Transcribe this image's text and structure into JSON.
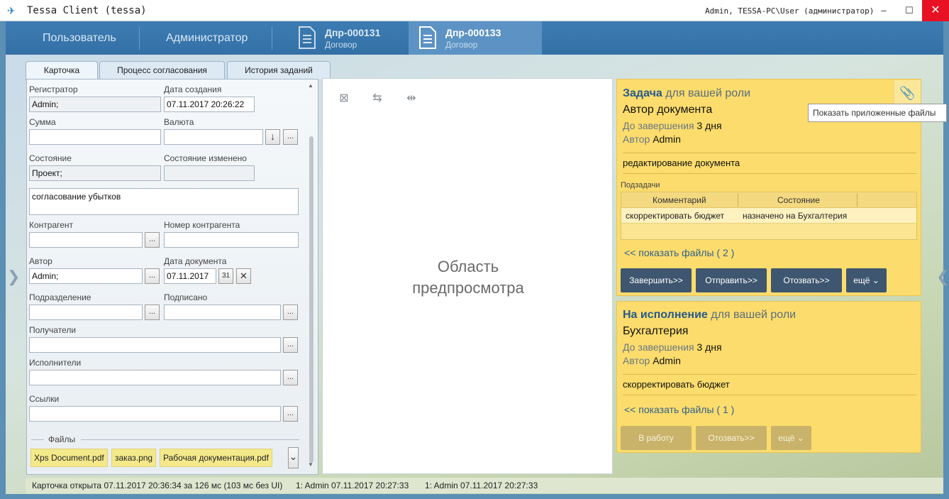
{
  "window": {
    "title": "Tessa Client (tessa)",
    "user": "Admin, TESSA-PC\\User (администратор)",
    "min_label": "–",
    "max_label": "☐",
    "close_label": "✕"
  },
  "nav": {
    "user": "Пользователь",
    "admin": "Администратор",
    "docs": [
      {
        "title": "Дпр-000131",
        "sub": "Договор"
      },
      {
        "title": "Дпр-000133",
        "sub": "Договор"
      }
    ]
  },
  "tabs": [
    "Карточка",
    "Процесс согласования",
    "История заданий"
  ],
  "card": {
    "registrar_label": "Регистратор",
    "registrar_value": "Admin;",
    "created_label": "Дата создания",
    "created_value": "07.11.2017  20:26:22",
    "sum_label": "Сумма",
    "sum_value": "",
    "currency_label": "Валюта",
    "currency_value": "",
    "state_label": "Состояние",
    "state_value": "Проект;",
    "state_changed_label": "Состояние изменено",
    "state_changed_value": "",
    "description": "согласование убытков",
    "partner_label": "Контрагент",
    "partner_value": "",
    "partner_number_label": "Номер контрагента",
    "partner_number_value": "",
    "author_label": "Автор",
    "author_value": "Admin;",
    "doc_date_label": "Дата документа",
    "doc_date_value": "07.11.2017",
    "calendar_day": "31",
    "department_label": "Подразделение",
    "department_value": "",
    "signed_label": "Подписано",
    "signed_value": "",
    "recipients_label": "Получатели",
    "executors_label": "Исполнители",
    "links_label": "Ссылки",
    "files_label": "Файлы",
    "files": [
      "Xps Document.pdf",
      "заказ.png",
      "Рабочая документация.pdf"
    ],
    "ellipsis": "...",
    "download_arrow": "↓",
    "clear_x": "✕",
    "dropdown_arrow": "⌄"
  },
  "preview": {
    "caption": "Область предпросмотра",
    "tool_close": "⊠",
    "tool_swap": "⇆",
    "tool_split": "⇹"
  },
  "tasks": [
    {
      "kind": "Задача",
      "for_role": "для вашей роли",
      "role": "Автор документа",
      "due_label": "До завершения",
      "due_value": "3 дня",
      "author_label": "Автор",
      "author_value": "Admin",
      "text": "редактирование документа",
      "subtasks_label": "Подзадачи",
      "subtasks_cols": [
        "Комментарий",
        "Состояние"
      ],
      "subtasks": [
        {
          "comment": "скорректировать бюджет",
          "state": "назначено на Бухгалтерия"
        }
      ],
      "files_link": "<< показать файлы ( 2 )",
      "buttons": [
        "Завершить>>",
        "Отправить>>",
        "Отозвать>>",
        "ещё ⌄"
      ]
    },
    {
      "kind": "На исполнение",
      "for_role": "для вашей роли",
      "role": "Бухгалтерия",
      "due_label": "До завершения",
      "due_value": "3 дня",
      "author_label": "Автор",
      "author_value": "Admin",
      "text": "скорректировать бюджет",
      "files_link": "<< показать файлы ( 1 )",
      "buttons": [
        "В работу",
        "Отозвать>>",
        "ещё ⌄"
      ]
    }
  ],
  "tooltip": "Показать приложенные файлы",
  "status": {
    "opened": "Карточка открыта 07.11.2017 20:36:34 за 126 мс (103 мс без UI)",
    "entry1": "1:  Admin  07.11.2017 20:27:33",
    "entry2": "1:  Admin  07.11.2017 20:27:33"
  },
  "colors": {
    "accent": "#3d7cb2",
    "task_bg": "#fbdc6c",
    "task_button": "#3e5670",
    "close_button": "#e81123"
  }
}
